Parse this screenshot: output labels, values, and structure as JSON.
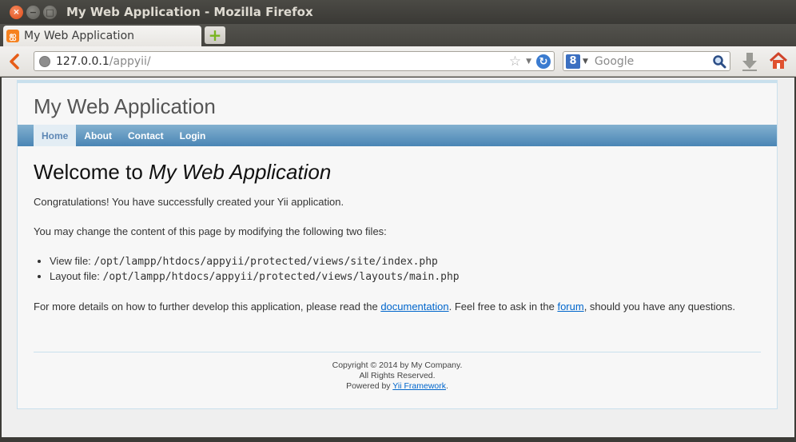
{
  "window": {
    "title": "My Web Application - Mozilla Firefox",
    "buttons": {
      "close": "×",
      "minimize": "−",
      "maximize": "□"
    }
  },
  "tabs": [
    {
      "label": "My Web Application",
      "icon": "xampp-favicon-icon",
      "favicon_letter": "ஐ"
    }
  ],
  "newtab": {
    "label": "+"
  },
  "navbar": {
    "url_host": "127.0.0.1",
    "url_path": "/appyii/",
    "search_placeholder": "Google",
    "search_engine_letter": "8"
  },
  "site": {
    "title": "My Web Application",
    "menu": [
      {
        "label": "Home",
        "active": true
      },
      {
        "label": "About",
        "active": false
      },
      {
        "label": "Contact",
        "active": false
      },
      {
        "label": "Login",
        "active": false
      }
    ]
  },
  "content": {
    "heading_prefix": "Welcome to ",
    "heading_emphasis": "My Web Application",
    "intro": "Congratulations! You have successfully created your Yii application.",
    "change_text": "You may change the content of this page by modifying the following two files:",
    "files": [
      {
        "label": "View file: ",
        "path": "/opt/lampp/htdocs/appyii/protected/views/site/index.php"
      },
      {
        "label": "Layout file: ",
        "path": "/opt/lampp/htdocs/appyii/protected/views/layouts/main.php"
      }
    ],
    "details_before": "For more details on how to further develop this application, please read the ",
    "details_link1": "documentation",
    "details_middle": ". Feel free to ask in the ",
    "details_link2": "forum",
    "details_after": ", should you have any questions."
  },
  "footer": {
    "copyright": "Copyright © 2014 by My Company.",
    "rights": "All Rights Reserved.",
    "powered_prefix": "Powered by ",
    "powered_link": "Yii Framework",
    "powered_suffix": "."
  },
  "colors": {
    "menu_blue": "#4a85b5",
    "link": "#06c",
    "close_orange": "#df4a16"
  }
}
